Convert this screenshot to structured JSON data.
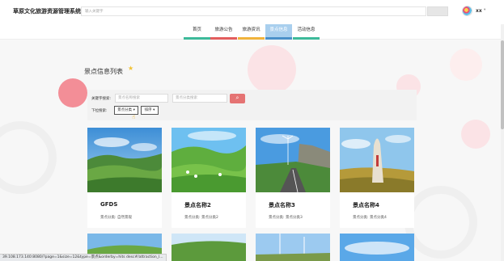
{
  "header": {
    "site_title": "草原文化旅游资源管理系统",
    "search_placeholder": "输入关键字",
    "username": "xx",
    "caret": "▾"
  },
  "nav": {
    "tabs": [
      {
        "label": "首页",
        "color": "#3dba9a",
        "active": false
      },
      {
        "label": "旅游公告",
        "color": "#e35d5d",
        "active": false
      },
      {
        "label": "旅游资讯",
        "color": "#f1b33c",
        "active": false
      },
      {
        "label": "景点信息",
        "color": "#4a90c9",
        "active": true
      },
      {
        "label": "活动信息",
        "color": "#3dba9a",
        "active": false
      }
    ]
  },
  "section": {
    "title": "景点信息列表",
    "star": "★"
  },
  "filter": {
    "keyword_label": "关键字搜索:",
    "name_placeholder": "景点名称搜索",
    "category_placeholder": "景点分类搜索",
    "dropdown_label": "下拉搜索:",
    "category_select": "景点分类 ▾",
    "sort_select": "排序 ▾",
    "search_icon": "⌕"
  },
  "cards": [
    {
      "name": "GFDS",
      "category": "景点分类: 自然景观"
    },
    {
      "name": "景点名称2",
      "category": "景点分类: 景点分类2"
    },
    {
      "name": "景点名称3",
      "category": "景点分类: 景点分类3"
    },
    {
      "name": "景点名称4",
      "category": "景点分类: 景点分类4"
    }
  ],
  "status_bar": {
    "url": "39.108.173.140:8080/?page=1&size=12&type=景点&orderby=hits desc#/attraction_l..."
  },
  "colors": {
    "accent_red": "#e57373",
    "active_tab": "#a9cfee"
  }
}
